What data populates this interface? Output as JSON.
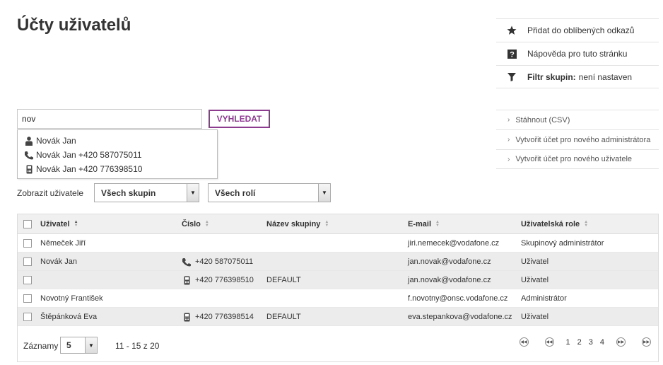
{
  "page": {
    "title": "Účty uživatelů"
  },
  "favorites": {
    "add_label": "Přidat do oblíbených odkazů",
    "help_label": "Nápověda pro tuto stránku",
    "filter_bold": "Filtr skupin:",
    "filter_value": "není nastaven"
  },
  "actions": {
    "download_csv": "Stáhnout (CSV)",
    "create_admin": "Vytvořit účet pro nového administrátora",
    "create_user": "Vytvořit účet pro nového uživatele"
  },
  "search": {
    "value": "nov",
    "button_label": "VYHLEDAT"
  },
  "suggestions": [
    {
      "icon": "person-icon",
      "text": "Novák Jan"
    },
    {
      "icon": "phone-icon",
      "text": "Novák Jan +420 587075011"
    },
    {
      "icon": "mobile-icon",
      "text": "Novák Jan +420 776398510"
    }
  ],
  "filters": {
    "label": "Zobrazit uživatele",
    "group_value": "Všech skupin",
    "role_value": "Všech rolí"
  },
  "table": {
    "headers": {
      "user": "Uživatel",
      "number": "Číslo",
      "group": "Název skupiny",
      "email": "E-mail",
      "role": "Uživatelská role"
    },
    "rows": [
      {
        "user": "Němeček Jiří",
        "number": "",
        "number_icon": "",
        "group": "",
        "email": "jiri.nemecek@vodafone.cz",
        "role": "Skupinový administrátor"
      },
      {
        "user": "Novák Jan",
        "number": "+420 587075011",
        "number_icon": "phone-icon",
        "group": "",
        "email": "jan.novak@vodafone.cz",
        "role": "Uživatel"
      },
      {
        "user": "",
        "number": "+420 776398510",
        "number_icon": "mobile-icon",
        "group": "DEFAULT",
        "email": "jan.novak@vodafone.cz",
        "role": "Uživatel"
      },
      {
        "user": "Novotný František",
        "number": "",
        "number_icon": "",
        "group": "",
        "email": "f.novotny@onsc.vodafone.cz",
        "role": "Administrátor"
      },
      {
        "user": "Štěpánková Eva",
        "number": "+420 776398514",
        "number_icon": "mobile-icon",
        "group": "DEFAULT",
        "email": "eva.stepankova@vodafone.cz",
        "role": "Uživatel"
      }
    ]
  },
  "footer": {
    "records_label": "Záznamy",
    "records_value": "5",
    "range_text": "11 - 15 z 20",
    "pages": [
      "1",
      "2",
      "3",
      "4"
    ],
    "current_page": "3"
  }
}
